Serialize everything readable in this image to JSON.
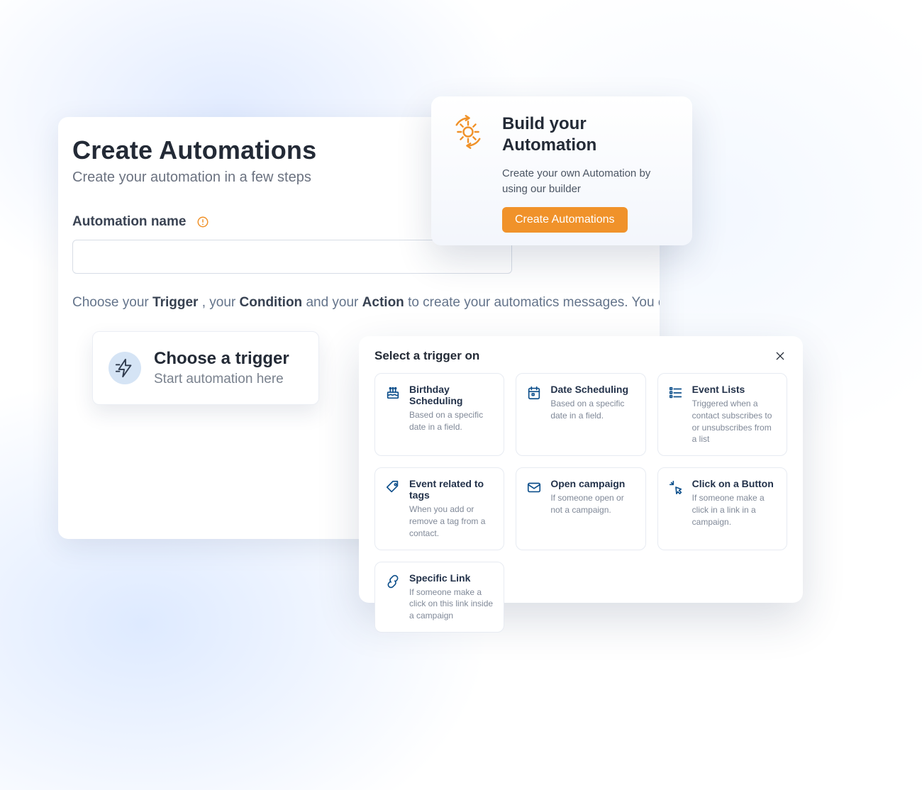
{
  "colors": {
    "accent": "#f0922a",
    "iconBlue": "#0d4f8b"
  },
  "main": {
    "title": "Create Automations",
    "subtitle": "Create your automation in a few steps",
    "nameLabel": "Automation name",
    "nameValue": "",
    "helper": {
      "pre": "Choose your ",
      "b1": "Trigger",
      "mid1": ", your ",
      "b2": "Condition",
      "mid2": " and your ",
      "b3": "Action",
      "post": " to create your automatics messages. You can select several condi"
    }
  },
  "triggerCard": {
    "title": "Choose a trigger",
    "subtitle": "Start automation here"
  },
  "promo": {
    "title": "Build your Automation",
    "description": "Create your own Automation by using our builder",
    "cta": "Create Automations"
  },
  "popover": {
    "title": "Select a trigger on",
    "options": [
      {
        "icon": "birthday",
        "title": "Birthday Scheduling",
        "desc": "Based on a specific date in a field."
      },
      {
        "icon": "calendar",
        "title": "Date Scheduling",
        "desc": "Based on a specific date in a field."
      },
      {
        "icon": "list",
        "title": "Event Lists",
        "desc": "Triggered when a contact subscribes to or unsubscribes from a list"
      },
      {
        "icon": "tag",
        "title": "Event related to tags",
        "desc": "When you add or remove a tag from a contact."
      },
      {
        "icon": "envelope",
        "title": "Open campaign",
        "desc": "If someone open or not a campaign."
      },
      {
        "icon": "click",
        "title": "Click on a Button",
        "desc": "If someone make a click in a link in a campaign."
      },
      {
        "icon": "link",
        "title": "Specific Link",
        "desc": "If someone make a click on this link inside a campaign"
      }
    ]
  }
}
